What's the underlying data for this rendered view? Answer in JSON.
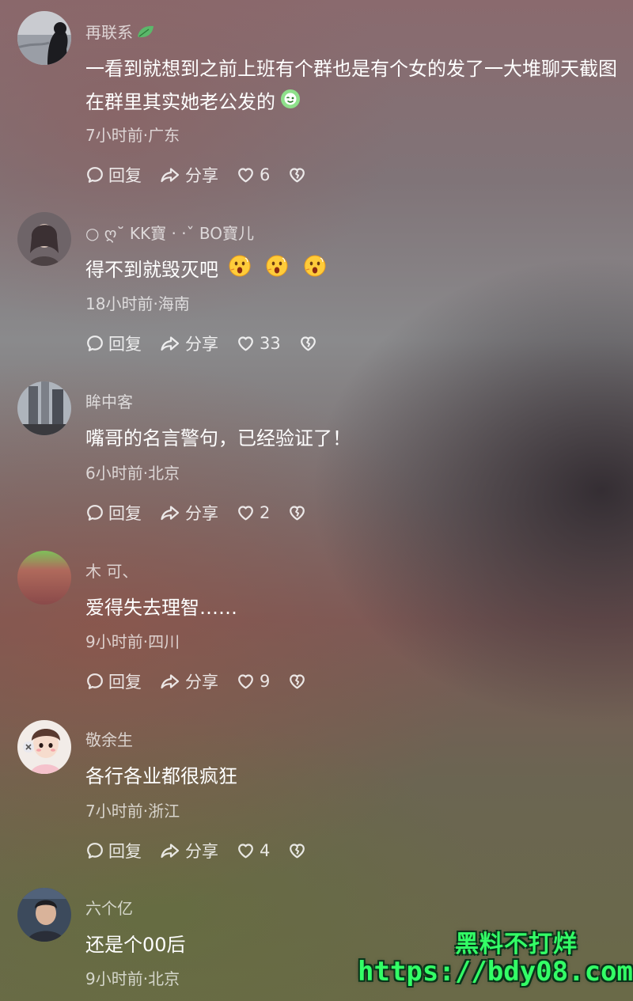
{
  "comments": [
    {
      "username": "再联系",
      "text": "一看到就想到之前上班有个群也是有个女的发了一大堆聊天截图在群里其实她老公发的",
      "meta": "7小时前·广东",
      "reply_label": "回复",
      "share_label": "分享",
      "likes": "6"
    },
    {
      "username": "○ ღ˘ KK寶 · ·ˇ BO寶儿",
      "text": "得不到就毁灭吧",
      "meta": "18小时前·海南",
      "reply_label": "回复",
      "share_label": "分享",
      "likes": "33"
    },
    {
      "username": "眸中客",
      "text": "嘴哥的名言警句，已经验证了！",
      "meta": "6小时前·北京",
      "reply_label": "回复",
      "share_label": "分享",
      "likes": "2"
    },
    {
      "username": "木 可、",
      "text": "爱得失去理智……",
      "meta": "9小时前·四川",
      "reply_label": "回复",
      "share_label": "分享",
      "likes": "9"
    },
    {
      "username": "敬余生",
      "text": "各行各业都很疯狂",
      "meta": "7小时前·浙江",
      "reply_label": "回复",
      "share_label": "分享",
      "likes": "4"
    },
    {
      "username": "六个亿",
      "text": "还是个00后",
      "meta": "9小时前·北京"
    }
  ],
  "watermark": {
    "line1": "黑料不打烊",
    "line2": "https://bdy08.com"
  },
  "colors": {
    "text": "#ffffff",
    "muted": "#d9d0d0",
    "watermark": "#33ff66"
  },
  "icons": [
    "leaf-icon",
    "comment-bubble-icon",
    "share-arrow-icon",
    "heart-icon",
    "broken-heart-icon",
    "surprised-emoji-icon",
    "wink-emoji-icon"
  ]
}
